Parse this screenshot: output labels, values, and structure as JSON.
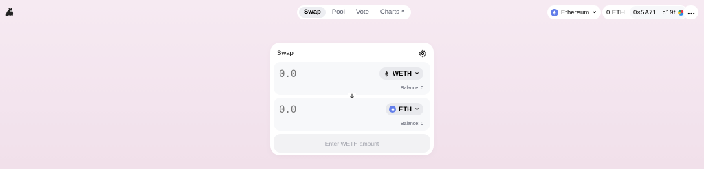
{
  "header": {
    "logo_icon": "unicorn-logo-icon",
    "nav": [
      {
        "label": "Swap",
        "active": true
      },
      {
        "label": "Pool",
        "active": false
      },
      {
        "label": "Vote",
        "active": false
      },
      {
        "label": "Charts",
        "active": false,
        "external": "↗"
      }
    ],
    "network": {
      "label": "Ethereum",
      "icon": "ethereum-icon"
    },
    "account": {
      "balance": "0 ETH",
      "address": "0×5A71...c19f"
    },
    "more_icon": "ellipsis-icon"
  },
  "swap": {
    "title": "Swap",
    "settings_icon": "gear-icon",
    "input": {
      "placeholder": "0.0",
      "token": "WETH",
      "balance": "Balance: 0"
    },
    "output": {
      "placeholder": "0.0",
      "token": "ETH",
      "balance": "Balance: 0"
    },
    "switch_icon": "arrow-down-icon",
    "submit_label": "Enter WETH amount"
  },
  "colors": {
    "eth_blue": "#627eea",
    "background": "#f6eaf2"
  }
}
